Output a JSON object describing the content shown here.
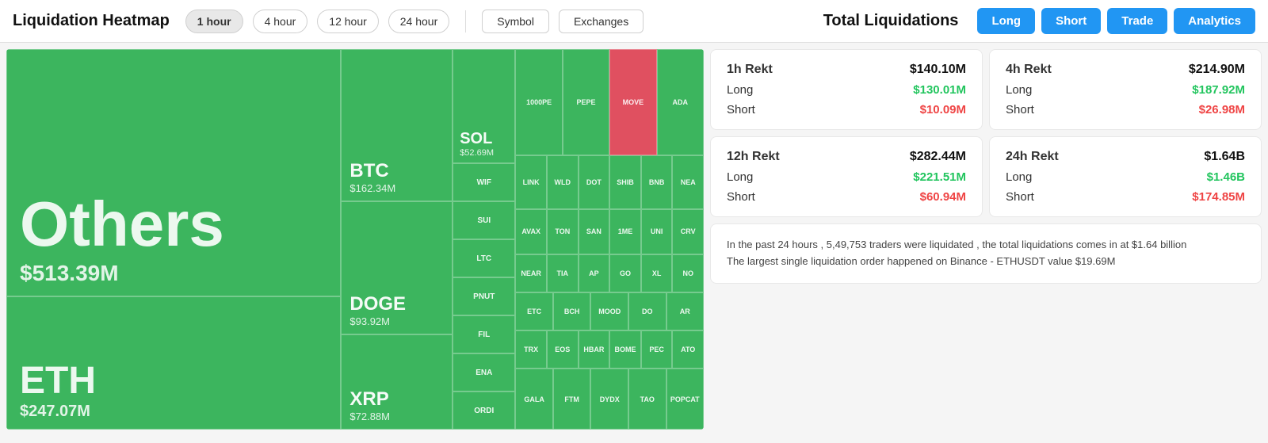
{
  "header": {
    "logo": "Liquidation Heatmap",
    "time_buttons": [
      {
        "label": "1 hour",
        "active": true
      },
      {
        "label": "4 hour",
        "active": false
      },
      {
        "label": "12 hour",
        "active": false
      },
      {
        "label": "24 hour",
        "active": false
      }
    ],
    "filter_buttons": [
      {
        "label": "Symbol"
      },
      {
        "label": "Exchanges"
      }
    ],
    "section_title": "Total Liquidations",
    "action_buttons": [
      {
        "label": "Long",
        "class": "btn-long"
      },
      {
        "label": "Short",
        "class": "btn-short"
      },
      {
        "label": "Trade",
        "class": "btn-trade"
      },
      {
        "label": "Analytics",
        "class": "btn-analytics"
      }
    ]
  },
  "heatmap": {
    "cells": [
      {
        "ticker": "Others",
        "amount": "$513.39M"
      },
      {
        "ticker": "ETH",
        "amount": "$247.07M"
      },
      {
        "ticker": "BTC",
        "amount": "$162.34M"
      },
      {
        "ticker": "DOGE",
        "amount": "$93.92M"
      },
      {
        "ticker": "XRP",
        "amount": "$72.88M"
      },
      {
        "ticker": "SOL",
        "amount": "$52.69M"
      },
      {
        "ticker": "1000PE"
      },
      {
        "ticker": "PEPE"
      },
      {
        "ticker": "MOVE",
        "color": "red"
      },
      {
        "ticker": "ADA"
      },
      {
        "ticker": "WIF"
      },
      {
        "ticker": "LINK"
      },
      {
        "ticker": "WLD"
      },
      {
        "ticker": "DOT"
      },
      {
        "ticker": "SHIB"
      },
      {
        "ticker": "BNB"
      },
      {
        "ticker": "NEA"
      },
      {
        "ticker": "SUI"
      },
      {
        "ticker": "AVAX"
      },
      {
        "ticker": "TON"
      },
      {
        "ticker": "SAN"
      },
      {
        "ticker": "1ME"
      },
      {
        "ticker": "UNI"
      },
      {
        "ticker": "CRV"
      },
      {
        "ticker": "LTC"
      },
      {
        "ticker": "NEAR"
      },
      {
        "ticker": "TIA"
      },
      {
        "ticker": "AP"
      },
      {
        "ticker": "GO"
      },
      {
        "ticker": "XL"
      },
      {
        "ticker": "NO"
      },
      {
        "ticker": "PNUT"
      },
      {
        "ticker": "ETC"
      },
      {
        "ticker": "BCH"
      },
      {
        "ticker": "MOOD"
      },
      {
        "ticker": "DO"
      },
      {
        "ticker": "AR"
      },
      {
        "ticker": "FIL"
      },
      {
        "ticker": "TRX"
      },
      {
        "ticker": "EOS"
      },
      {
        "ticker": "HBAR"
      },
      {
        "ticker": "BOME"
      },
      {
        "ticker": "PEC"
      },
      {
        "ticker": "ATO"
      },
      {
        "ticker": "ENA"
      },
      {
        "ticker": "GALA"
      },
      {
        "ticker": "FTM"
      },
      {
        "ticker": "DYDX"
      },
      {
        "ticker": "TAO"
      },
      {
        "ticker": "ORDI"
      },
      {
        "ticker": "POPCAT"
      }
    ]
  },
  "stats": {
    "1h": {
      "rekt_label": "1h Rekt",
      "rekt_value": "$140.10M",
      "long_label": "Long",
      "long_value": "$130.01M",
      "short_label": "Short",
      "short_value": "$10.09M"
    },
    "4h": {
      "rekt_label": "4h Rekt",
      "rekt_value": "$214.90M",
      "long_label": "Long",
      "long_value": "$187.92M",
      "short_label": "Short",
      "short_value": "$26.98M"
    },
    "12h": {
      "rekt_label": "12h Rekt",
      "rekt_value": "$282.44M",
      "long_label": "Long",
      "long_value": "$221.51M",
      "short_label": "Short",
      "short_value": "$60.94M"
    },
    "24h": {
      "rekt_label": "24h Rekt",
      "rekt_value": "$1.64B",
      "long_label": "Long",
      "long_value": "$1.46B",
      "short_label": "Short",
      "short_value": "$174.85M"
    }
  },
  "info": {
    "line1": "In the past 24 hours , 5,49,753 traders were liquidated , the total liquidations comes in at $1.64 billion",
    "line2": "The largest single liquidation order happened on Binance - ETHUSDT value $19.69M"
  }
}
